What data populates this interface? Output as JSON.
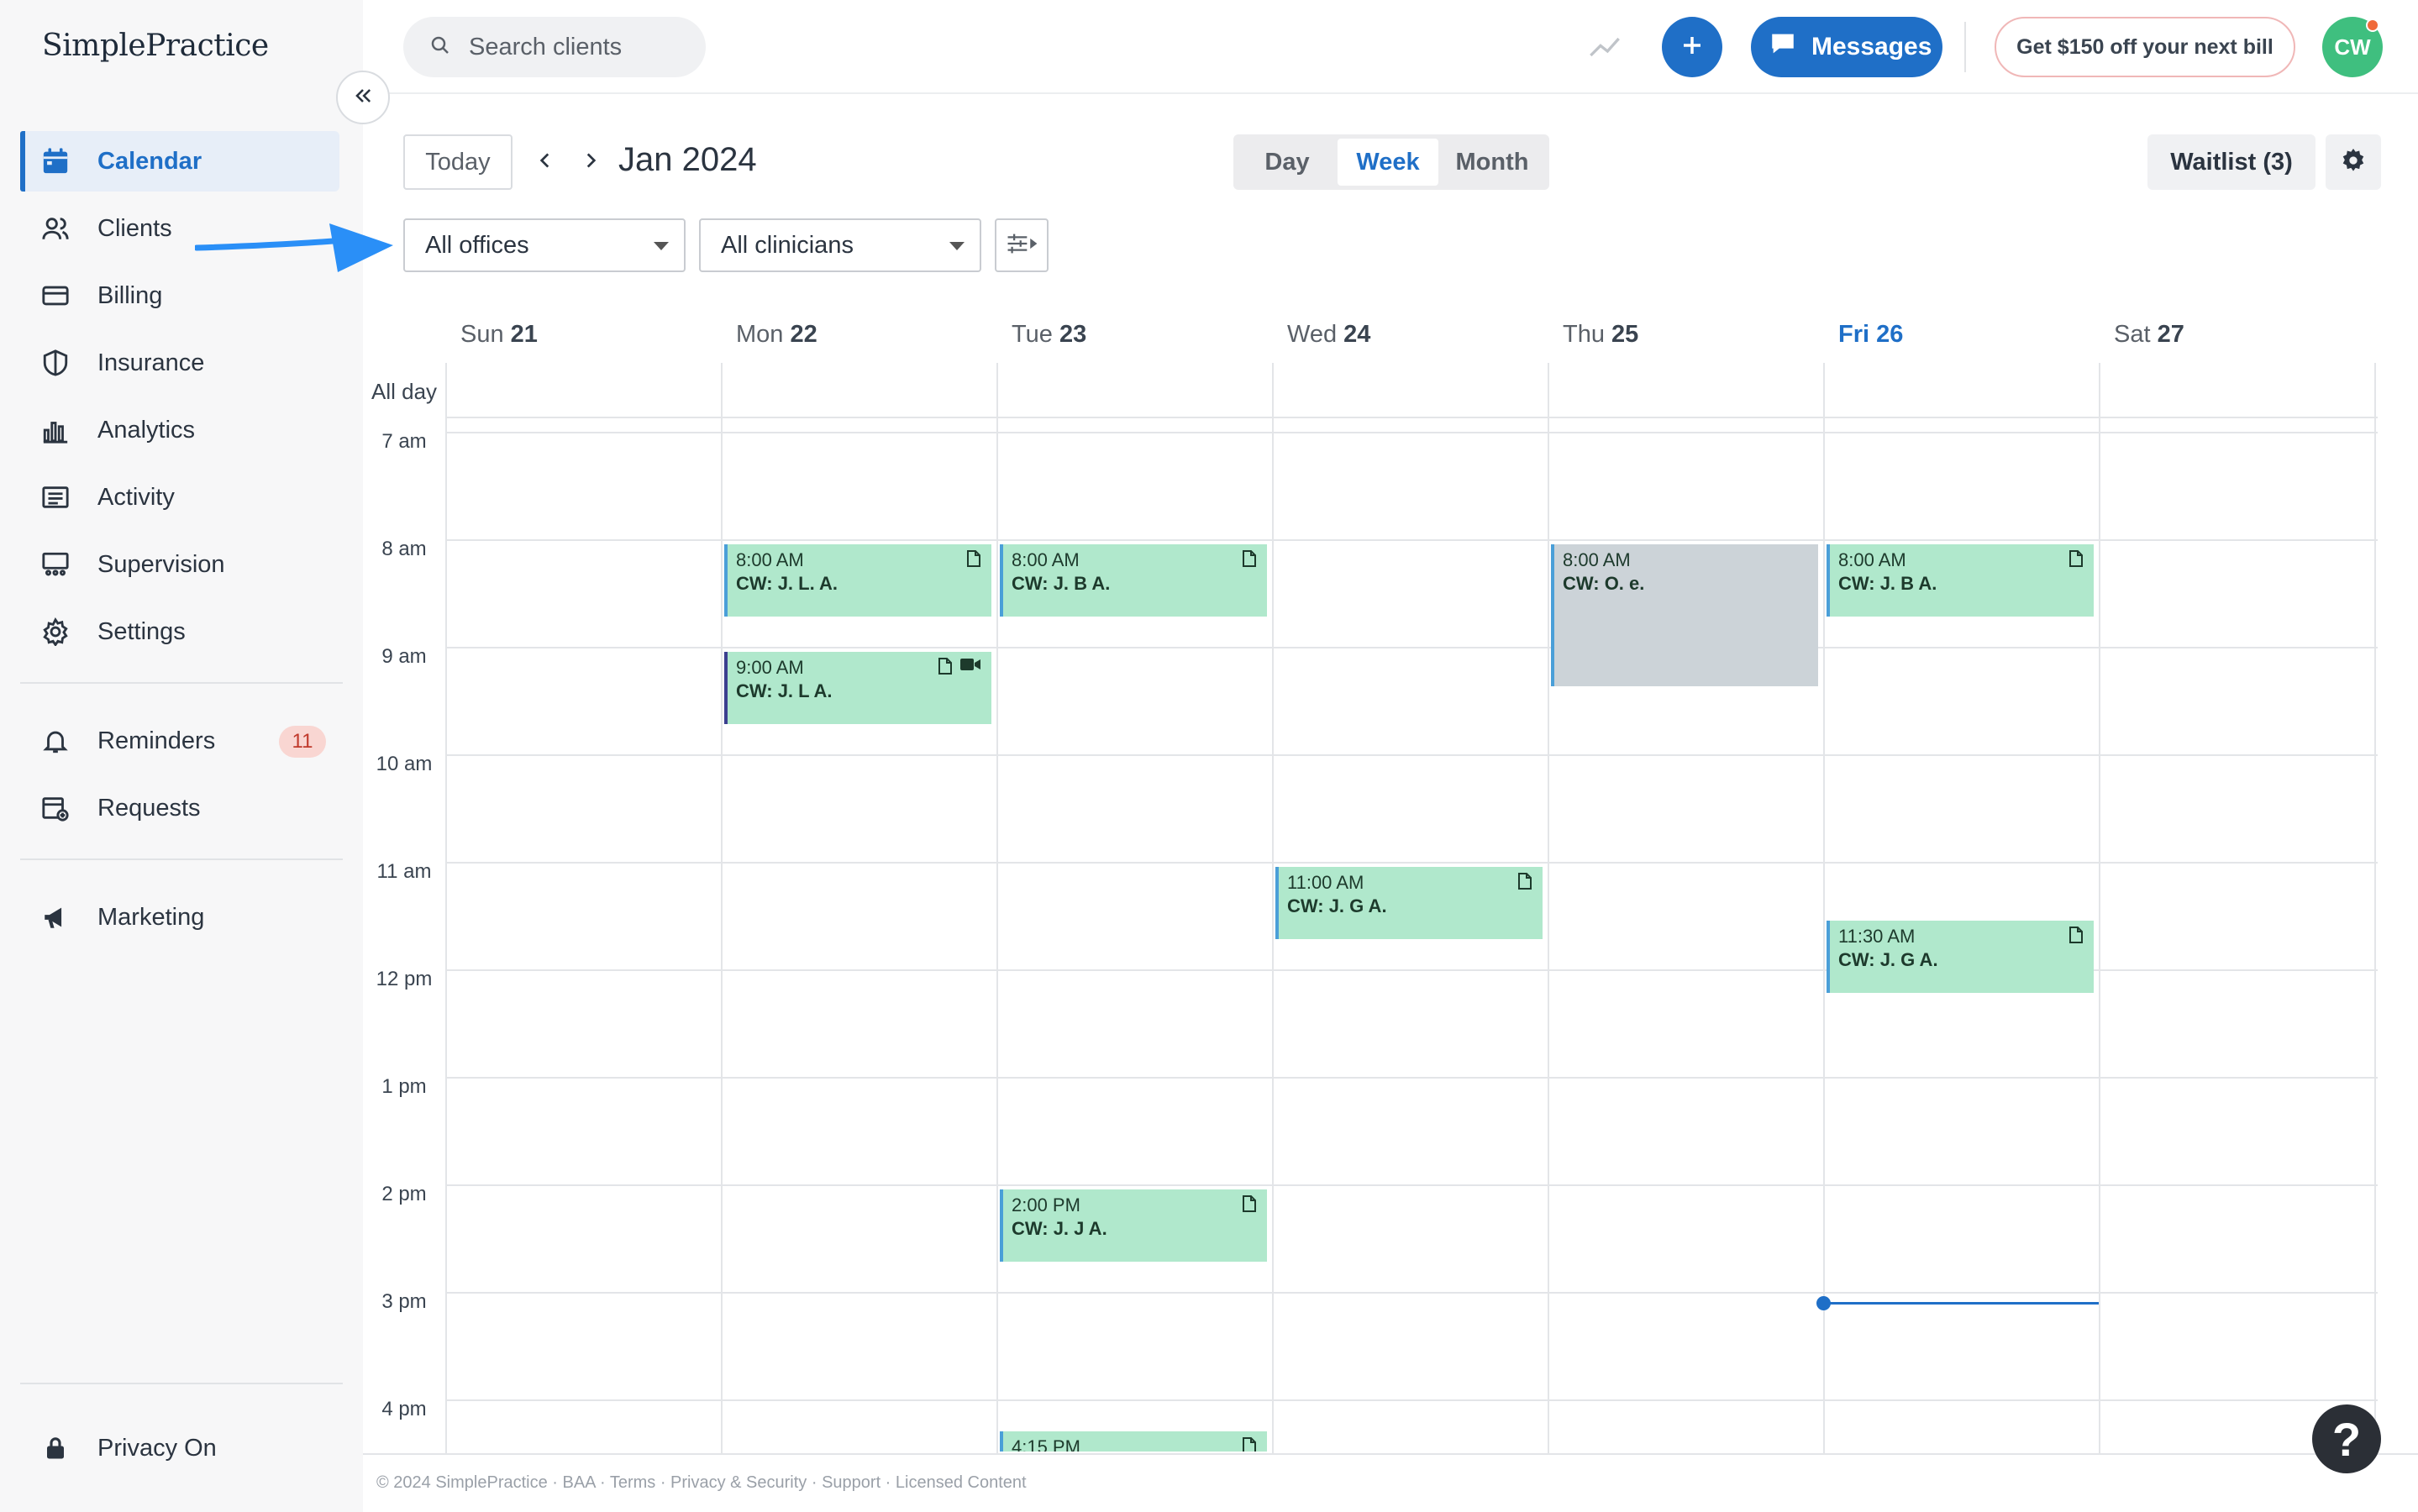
{
  "app": {
    "logo_text": "SimplePractice"
  },
  "sidebar": {
    "items": [
      {
        "label": "Calendar",
        "icon": "calendar-icon",
        "active": true
      },
      {
        "label": "Clients",
        "icon": "clients-icon"
      },
      {
        "label": "Billing",
        "icon": "billing-card-icon"
      },
      {
        "label": "Insurance",
        "icon": "shield-icon"
      },
      {
        "label": "Analytics",
        "icon": "bar-chart-icon"
      },
      {
        "label": "Activity",
        "icon": "list-icon"
      },
      {
        "label": "Supervision",
        "icon": "supervision-icon"
      },
      {
        "label": "Settings",
        "icon": "gear-icon"
      }
    ],
    "secondary": [
      {
        "label": "Reminders",
        "icon": "bell-icon",
        "badge": "11"
      },
      {
        "label": "Requests",
        "icon": "calendar-plus-icon"
      }
    ],
    "marketing": {
      "label": "Marketing",
      "icon": "megaphone-icon"
    },
    "privacy": {
      "label": "Privacy On",
      "icon": "lock-icon"
    }
  },
  "topbar": {
    "search_placeholder": "Search clients",
    "messages_label": "Messages",
    "promo_label": "Get $150 off your next bill",
    "avatar_initials": "CW"
  },
  "toolbar": {
    "today_label": "Today",
    "month_label": "Jan 2024",
    "views": [
      "Day",
      "Week",
      "Month"
    ],
    "active_view": "Week",
    "waitlist_label": "Waitlist (3)",
    "office_filter": "All offices",
    "clinician_filter": "All clinicians"
  },
  "calendar": {
    "days": [
      {
        "name": "Sun",
        "num": "21"
      },
      {
        "name": "Mon",
        "num": "22"
      },
      {
        "name": "Tue",
        "num": "23"
      },
      {
        "name": "Wed",
        "num": "24"
      },
      {
        "name": "Thu",
        "num": "25"
      },
      {
        "name": "Fri",
        "num": "26",
        "today": true
      },
      {
        "name": "Sat",
        "num": "27"
      }
    ],
    "all_day_label": "All day",
    "hours": [
      "7 am",
      "8 am",
      "9 am",
      "10 am",
      "11 am",
      "12 pm",
      "1 pm",
      "2 pm",
      "3 pm",
      "4 pm"
    ],
    "events": [
      {
        "day": 1,
        "start": 8.0,
        "duration": 0.75,
        "time": "8:00 AM",
        "title": "CW: J. L. A.",
        "icons": [
          "document-icon"
        ]
      },
      {
        "day": 1,
        "start": 9.0,
        "duration": 0.75,
        "time": "9:00 AM",
        "title": "CW: J. L A.",
        "icons": [
          "document-icon",
          "video-icon"
        ],
        "style": "dark"
      },
      {
        "day": 2,
        "start": 8.0,
        "duration": 0.75,
        "time": "8:00 AM",
        "title": "CW: J. B A.",
        "icons": [
          "document-icon"
        ]
      },
      {
        "day": 2,
        "start": 14.0,
        "duration": 0.75,
        "time": "2:00 PM",
        "title": "CW: J. J A.",
        "icons": [
          "document-icon"
        ]
      },
      {
        "day": 2,
        "start": 16.25,
        "duration": 0.75,
        "time": "4:15 PM",
        "title": "",
        "icons": [
          "document-icon"
        ]
      },
      {
        "day": 3,
        "start": 11.0,
        "duration": 0.75,
        "time": "11:00 AM",
        "title": "CW: J. G A.",
        "icons": [
          "document-icon"
        ]
      },
      {
        "day": 4,
        "start": 8.0,
        "duration": 1.4,
        "time": "8:00 AM",
        "title": "CW: O. e.",
        "icons": [],
        "style": "gray"
      },
      {
        "day": 5,
        "start": 8.0,
        "duration": 0.75,
        "time": "8:00 AM",
        "title": "CW: J. B A.",
        "icons": [
          "document-icon"
        ]
      },
      {
        "day": 5,
        "start": 11.5,
        "duration": 0.75,
        "time": "11:30 AM",
        "title": "CW: J. G A.",
        "icons": [
          "document-icon"
        ]
      }
    ],
    "current_time": 15.1
  },
  "footer": {
    "text": "© 2024 SimplePractice · BAA · Terms · Privacy & Security · Support · Licensed Content"
  },
  "colors": {
    "accent": "#1f6fc7",
    "event_green": "#b0e8cc",
    "event_gray": "#ccd3d8",
    "avatar": "#3fbf7f"
  }
}
